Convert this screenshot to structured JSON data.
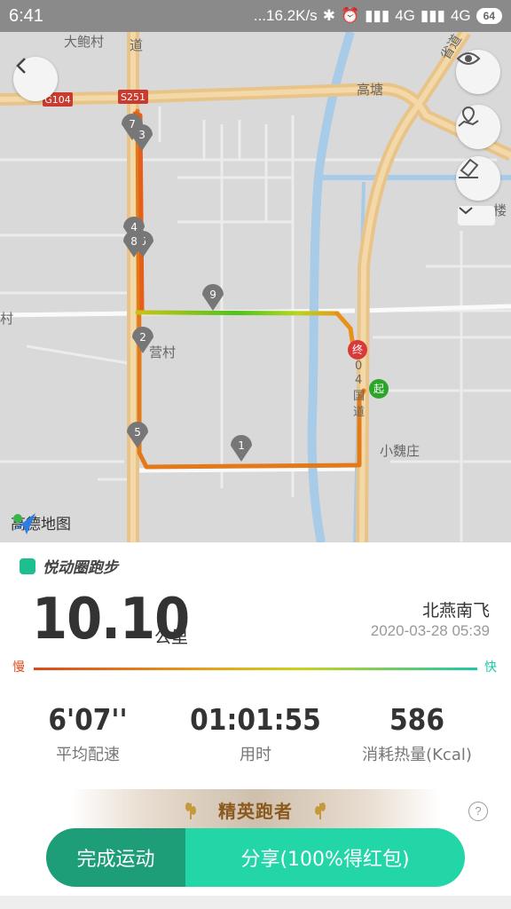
{
  "status_bar": {
    "time": "6:41",
    "speed": "...16.2K/s",
    "network1": "4G",
    "network2": "4G",
    "battery": "64"
  },
  "map": {
    "labels": {
      "village1": "大鲍村",
      "road_g104": "G104",
      "road_s251": "S251",
      "gaotang": "高塘",
      "yingcun": "营村",
      "xiaoweizhuang": "小魏庄",
      "road_left_top": "道",
      "road_right_top": "省道",
      "road_lou": "楼",
      "road_cun": "村",
      "road_vertical_1": "0",
      "road_vertical_2": "4",
      "road_vertical_3": "国",
      "road_vertical_4": "道"
    },
    "markers": {
      "start": "起",
      "end": "终",
      "km": [
        "1",
        "2",
        "3",
        "4",
        "5",
        "6",
        "7",
        "8",
        "9"
      ]
    },
    "buttons": [
      "back-icon",
      "eye-icon",
      "map-route-icon",
      "eraser-icon",
      "chevron-down-icon"
    ],
    "logo_text": "高德地图",
    "route_color_slow": "#d94a1a",
    "route_color_fast": "#1ec7a6"
  },
  "summary": {
    "brand": "悦动圈跑步",
    "distance": "10.10",
    "distance_unit": "公里",
    "user": "北燕南飞",
    "datetime": "2020-03-28 05:39",
    "slow_label": "慢",
    "fast_label": "快",
    "stats": [
      {
        "value": "6'07''",
        "label": "平均配速"
      },
      {
        "value": "01:01:55",
        "label": "用时"
      },
      {
        "value": "586",
        "label": "消耗热量(Kcal)"
      }
    ],
    "badge": "精英跑者",
    "help": "?",
    "finish_button": "完成运动",
    "share_button": "分享(100%得红包)"
  }
}
